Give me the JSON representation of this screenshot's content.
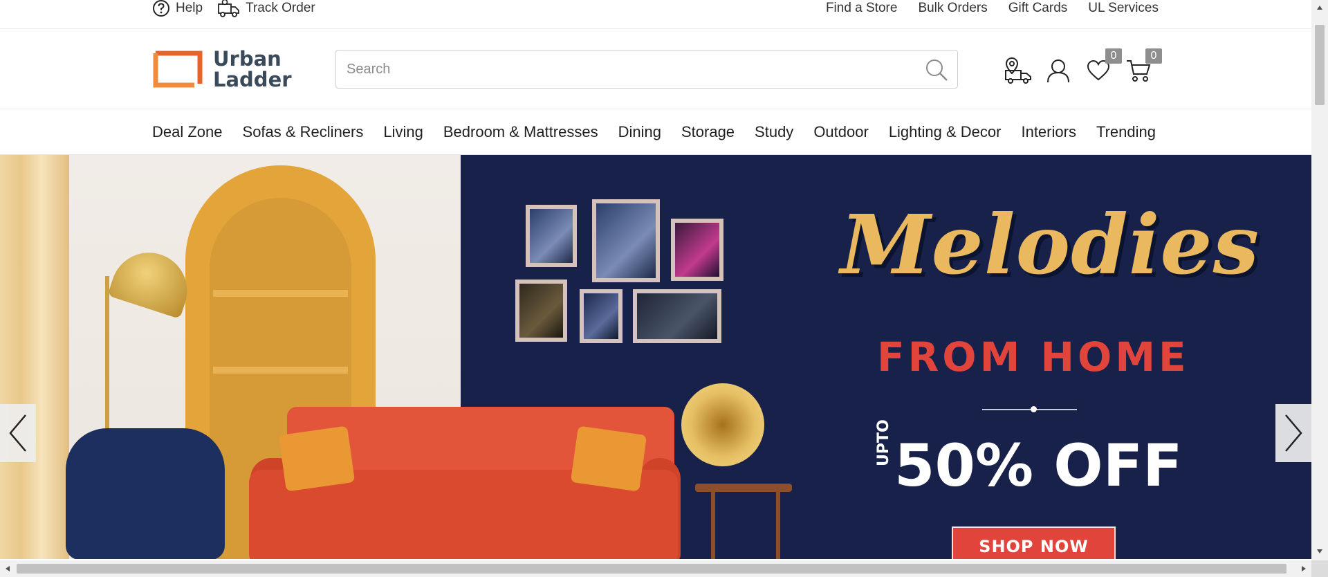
{
  "topbar": {
    "help_label": "Help",
    "track_order_label": "Track Order",
    "links": [
      "Find a Store",
      "Bulk Orders",
      "Gift Cards",
      "UL Services"
    ]
  },
  "header": {
    "logo_line1": "Urban",
    "logo_line2": "Ladder",
    "search_placeholder": "Search",
    "wishlist_count": "0",
    "cart_count": "0"
  },
  "nav": {
    "items": [
      "Deal Zone",
      "Sofas & Recliners",
      "Living",
      "Bedroom & Mattresses",
      "Dining",
      "Storage",
      "Study",
      "Outdoor",
      "Lighting & Decor",
      "Interiors",
      "Trending"
    ]
  },
  "hero": {
    "headline": "Melodies",
    "subheadline": "FROM HOME",
    "upto_label": "UPTO",
    "discount": "50% OFF",
    "cta_label": "SHOP NOW"
  },
  "colors": {
    "brand_orange": "#e8622c",
    "hero_navy": "#17214a",
    "hero_gold": "#e9b85f",
    "hero_red": "#e0443b"
  },
  "icons": {
    "help": "help-circle-icon",
    "track": "delivery-truck-icon",
    "search": "search-icon",
    "store_locator": "store-locator-truck-icon",
    "account": "user-profile-icon",
    "wishlist": "heart-icon",
    "cart": "shopping-cart-icon",
    "prev": "chevron-left-icon",
    "next": "chevron-right-icon"
  }
}
